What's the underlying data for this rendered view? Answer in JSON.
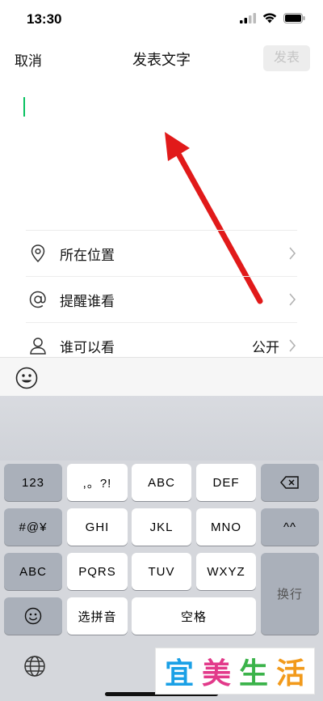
{
  "status": {
    "time": "13:30"
  },
  "nav": {
    "cancel": "取消",
    "title": "发表文字",
    "post": "发表"
  },
  "options": [
    {
      "label": "所在位置",
      "icon": "location-pin-icon",
      "value": ""
    },
    {
      "label": "提醒谁看",
      "icon": "at-sign-icon",
      "value": ""
    },
    {
      "label": "谁可以看",
      "icon": "person-icon",
      "value": "公开"
    }
  ],
  "keyboard": {
    "row1": [
      "123",
      ",。?!",
      "ABC",
      "DEF"
    ],
    "row2": [
      "#@¥",
      "GHI",
      "JKL",
      "MNO",
      "^^"
    ],
    "row3": [
      "ABC",
      "PQRS",
      "TUV",
      "WXYZ"
    ],
    "row4": [
      "选拼音",
      "空格"
    ],
    "enter": "换行"
  },
  "colors": {
    "caret": "#07c160",
    "arrow": "#e11a1a",
    "watermark": [
      "#1aa0e6",
      "#e23a8a",
      "#3bb34a",
      "#f29a1b"
    ]
  },
  "watermark": {
    "chars": [
      "宜",
      "美",
      "生",
      "活"
    ]
  }
}
